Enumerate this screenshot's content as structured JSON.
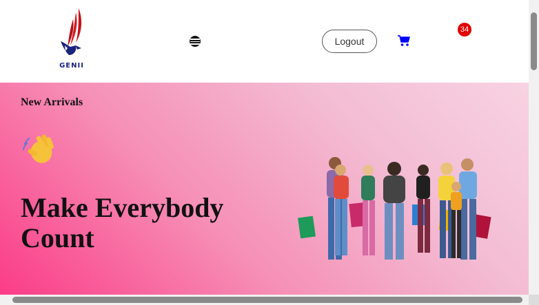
{
  "header": {
    "logo_text": "GENII",
    "menu_icon": "hamburger-icon",
    "logout_label": "Logout",
    "cart_icon": "shopping-cart-icon",
    "cart_count": "34",
    "cart_color": "#0000ff",
    "badge_color": "#e10000"
  },
  "hero": {
    "eyebrow": "New Arrivals",
    "emoji": "waving-hand-icon",
    "headline": "Make Everybody Count",
    "image": "group-of-shoppers-with-bags",
    "gradient": [
      "#fb3c87",
      "#f68fb6",
      "#f3bcd3",
      "#f8d3e2"
    ]
  }
}
